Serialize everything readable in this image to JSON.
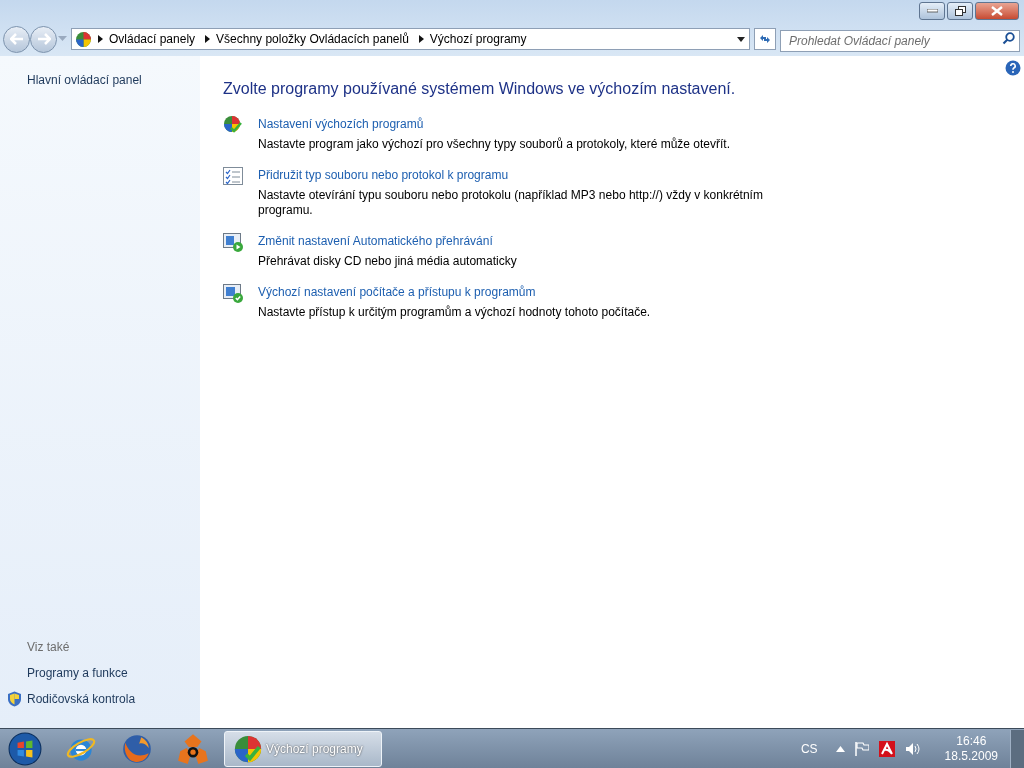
{
  "window": {
    "controls": [
      {
        "kind": "minimize"
      },
      {
        "kind": "restore"
      },
      {
        "kind": "close"
      }
    ]
  },
  "address_bar": {
    "breadcrumb": [
      "Ovládací panely",
      "Všechny položky Ovládacích panelů",
      "Výchozí programy"
    ]
  },
  "search": {
    "placeholder": "Prohledat Ovládací panely"
  },
  "sidebar": {
    "home_link": "Hlavní ovládací panel",
    "see_also": {
      "heading": "Viz také",
      "links": [
        {
          "label": "Programy a funkce",
          "kind": "plain"
        },
        {
          "label": "Rodičovská kontrola",
          "kind": "shield"
        }
      ]
    }
  },
  "content": {
    "heading": "Zvolte programy používané systémem Windows ve výchozím nastavení.",
    "tasks": [
      {
        "kind": "defaults",
        "title": "Nastavení výchozích programů",
        "description": "Nastavte program jako výchozí pro všechny typy souborů a protokoly, které může otevřít."
      },
      {
        "kind": "associate",
        "title": "Přidružit typ souboru nebo protokol k programu",
        "description": "Nastavte otevírání typu souboru nebo protokolu (například MP3 nebo http://) vždy v konkrétním programu."
      },
      {
        "kind": "autoplay",
        "title": "Změnit nastavení Automatického přehrávání",
        "description": "Přehrávat disky CD nebo jiná média automaticky"
      },
      {
        "kind": "access",
        "title": "Výchozí nastavení počítače a přístupu k programům",
        "description": "Nastavte přístup k určitým programům a výchozí hodnoty tohoto počítače."
      }
    ]
  },
  "taskbar": {
    "pinned": [
      {
        "kind": "start"
      },
      {
        "kind": "browser-e"
      },
      {
        "kind": "browser-fox"
      },
      {
        "kind": "tri"
      }
    ],
    "windows": [
      {
        "label": "Výchozí programy",
        "selected": true
      }
    ],
    "tray": {
      "language": "CS",
      "time": "16:46",
      "date": "18.5.2009"
    }
  }
}
